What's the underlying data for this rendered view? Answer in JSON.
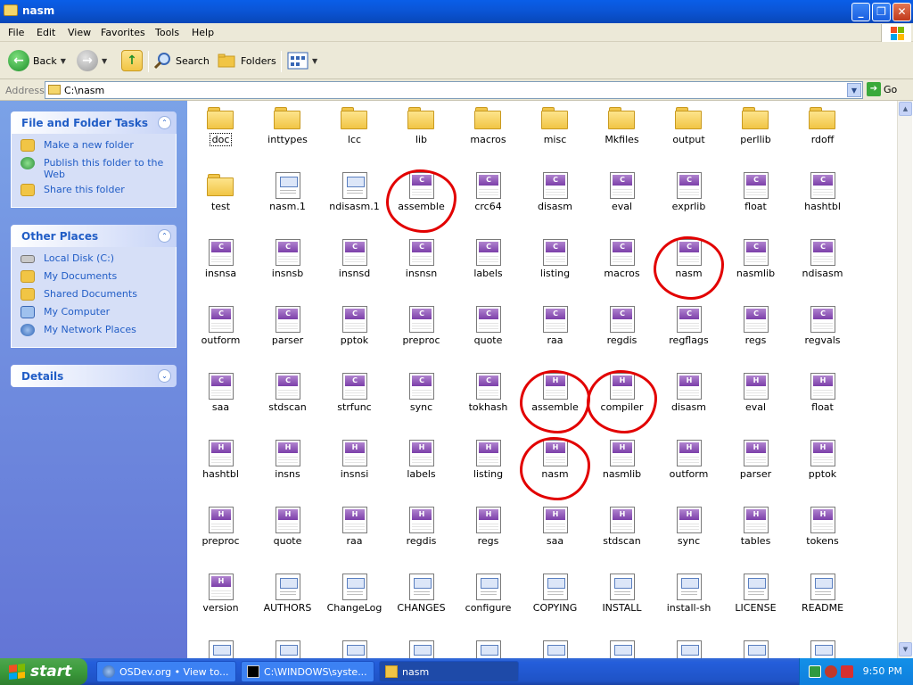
{
  "window": {
    "title": "nasm"
  },
  "menu": [
    "File",
    "Edit",
    "View",
    "Favorites",
    "Tools",
    "Help"
  ],
  "toolbar": {
    "back": "Back",
    "search": "Search",
    "folders": "Folders"
  },
  "address": {
    "label": "Address",
    "value": "C:\\nasm",
    "go": "Go"
  },
  "tasks_panel": {
    "title": "File and Folder Tasks",
    "links": [
      "Make a new folder",
      "Publish this folder to the Web",
      "Share this folder"
    ]
  },
  "places_panel": {
    "title": "Other Places",
    "links": [
      "Local Disk (C:)",
      "My Documents",
      "Shared Documents",
      "My Computer",
      "My Network Places"
    ]
  },
  "details_panel": {
    "title": "Details"
  },
  "files": [
    {
      "name": "doc",
      "type": "folder"
    },
    {
      "name": "inttypes",
      "type": "folder"
    },
    {
      "name": "lcc",
      "type": "folder"
    },
    {
      "name": "lib",
      "type": "folder"
    },
    {
      "name": "macros",
      "type": "folder"
    },
    {
      "name": "misc",
      "type": "folder"
    },
    {
      "name": "Mkfiles",
      "type": "folder"
    },
    {
      "name": "output",
      "type": "folder"
    },
    {
      "name": "perllib",
      "type": "folder"
    },
    {
      "name": "rdoff",
      "type": "folder"
    },
    {
      "name": "test",
      "type": "folder"
    },
    {
      "name": "nasm.1",
      "type": "doc"
    },
    {
      "name": "ndisasm.1",
      "type": "doc"
    },
    {
      "name": "assemble",
      "type": "c"
    },
    {
      "name": "crc64",
      "type": "c"
    },
    {
      "name": "disasm",
      "type": "c"
    },
    {
      "name": "eval",
      "type": "c"
    },
    {
      "name": "exprlib",
      "type": "c"
    },
    {
      "name": "float",
      "type": "c"
    },
    {
      "name": "hashtbl",
      "type": "c"
    },
    {
      "name": "insnsa",
      "type": "c"
    },
    {
      "name": "insnsb",
      "type": "c"
    },
    {
      "name": "insnsd",
      "type": "c"
    },
    {
      "name": "insnsn",
      "type": "c"
    },
    {
      "name": "labels",
      "type": "c"
    },
    {
      "name": "listing",
      "type": "c"
    },
    {
      "name": "macros",
      "type": "c"
    },
    {
      "name": "nasm",
      "type": "c"
    },
    {
      "name": "nasmlib",
      "type": "c"
    },
    {
      "name": "ndisasm",
      "type": "c"
    },
    {
      "name": "outform",
      "type": "c"
    },
    {
      "name": "parser",
      "type": "c"
    },
    {
      "name": "pptok",
      "type": "c"
    },
    {
      "name": "preproc",
      "type": "c"
    },
    {
      "name": "quote",
      "type": "c"
    },
    {
      "name": "raa",
      "type": "c"
    },
    {
      "name": "regdis",
      "type": "c"
    },
    {
      "name": "regflags",
      "type": "c"
    },
    {
      "name": "regs",
      "type": "c"
    },
    {
      "name": "regvals",
      "type": "c"
    },
    {
      "name": "saa",
      "type": "c"
    },
    {
      "name": "stdscan",
      "type": "c"
    },
    {
      "name": "strfunc",
      "type": "c"
    },
    {
      "name": "sync",
      "type": "c"
    },
    {
      "name": "tokhash",
      "type": "c"
    },
    {
      "name": "assemble",
      "type": "h"
    },
    {
      "name": "compiler",
      "type": "h"
    },
    {
      "name": "disasm",
      "type": "h"
    },
    {
      "name": "eval",
      "type": "h"
    },
    {
      "name": "float",
      "type": "h"
    },
    {
      "name": "hashtbl",
      "type": "h"
    },
    {
      "name": "insns",
      "type": "h"
    },
    {
      "name": "insnsi",
      "type": "h"
    },
    {
      "name": "labels",
      "type": "h"
    },
    {
      "name": "listing",
      "type": "h"
    },
    {
      "name": "nasm",
      "type": "h"
    },
    {
      "name": "nasmlib",
      "type": "h"
    },
    {
      "name": "outform",
      "type": "h"
    },
    {
      "name": "parser",
      "type": "h"
    },
    {
      "name": "pptok",
      "type": "h"
    },
    {
      "name": "preproc",
      "type": "h"
    },
    {
      "name": "quote",
      "type": "h"
    },
    {
      "name": "raa",
      "type": "h"
    },
    {
      "name": "regdis",
      "type": "h"
    },
    {
      "name": "regs",
      "type": "h"
    },
    {
      "name": "saa",
      "type": "h"
    },
    {
      "name": "stdscan",
      "type": "h"
    },
    {
      "name": "sync",
      "type": "h"
    },
    {
      "name": "tables",
      "type": "h"
    },
    {
      "name": "tokens",
      "type": "h"
    },
    {
      "name": "version",
      "type": "h"
    },
    {
      "name": "AUTHORS",
      "type": "doc"
    },
    {
      "name": "ChangeLog",
      "type": "doc"
    },
    {
      "name": "CHANGES",
      "type": "doc"
    },
    {
      "name": "configure",
      "type": "doc"
    },
    {
      "name": "COPYING",
      "type": "doc"
    },
    {
      "name": "INSTALL",
      "type": "doc"
    },
    {
      "name": "install-sh",
      "type": "doc"
    },
    {
      "name": "LICENSE",
      "type": "doc"
    },
    {
      "name": "README",
      "type": "doc"
    },
    {
      "name": "",
      "type": "doc"
    },
    {
      "name": "",
      "type": "doc"
    },
    {
      "name": "",
      "type": "doc"
    },
    {
      "name": "",
      "type": "doc"
    },
    {
      "name": "",
      "type": "doc"
    },
    {
      "name": "",
      "type": "doc"
    },
    {
      "name": "",
      "type": "doc"
    },
    {
      "name": "",
      "type": "doc"
    },
    {
      "name": "",
      "type": "doc"
    },
    {
      "name": "",
      "type": "doc"
    }
  ],
  "selected_file_index": 0,
  "annotated_file_indices": [
    13,
    27,
    45,
    46,
    55
  ],
  "taskbar": {
    "start": "start",
    "tasks": [
      "OSDev.org • View to...",
      "C:\\WINDOWS\\syste...",
      "nasm"
    ],
    "clock": "9:50 PM"
  },
  "colors": {
    "titlebar": "#0b56d8",
    "sidebar": "#7ba2e7",
    "annotation": "#e20000",
    "taskbar": "#245edb"
  }
}
